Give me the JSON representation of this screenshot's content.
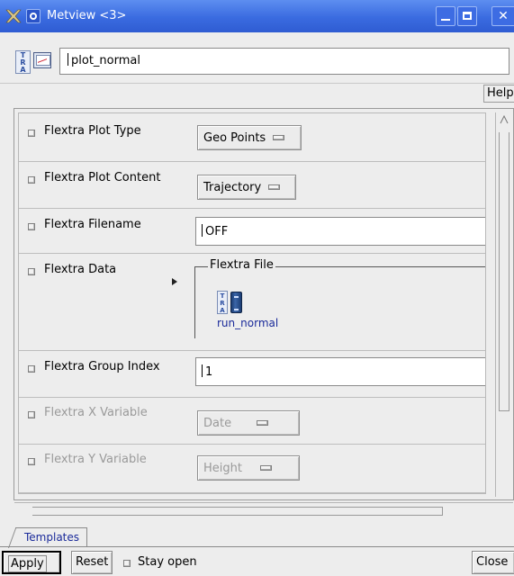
{
  "window": {
    "title": "Metview <3>"
  },
  "icon": {
    "name": "plot_normal"
  },
  "help_label": "Help",
  "params": [
    {
      "label": "Flextra Plot Type",
      "value": "Geo Points",
      "kind": "option",
      "enabled": true
    },
    {
      "label": "Flextra Plot Content",
      "value": "Trajectory",
      "kind": "option",
      "enabled": true
    },
    {
      "label": "Flextra Filename",
      "value": "OFF",
      "kind": "text",
      "enabled": true
    },
    {
      "label": "Flextra Data",
      "group_title": "Flextra File",
      "file_name": "run_normal",
      "file_icon_text": "TRA",
      "kind": "icon",
      "enabled": true
    },
    {
      "label": "Flextra Group Index",
      "value": "1",
      "kind": "text",
      "enabled": true
    },
    {
      "label": "Flextra X Variable",
      "value": "Date",
      "kind": "option",
      "enabled": false
    },
    {
      "label": "Flextra Y Variable",
      "value": "Height",
      "kind": "option",
      "enabled": false
    }
  ],
  "tabs": [
    {
      "label": "Templates"
    }
  ],
  "buttons": {
    "apply": "Apply",
    "reset": "Reset",
    "close": "Close"
  },
  "stay_open": {
    "label": "Stay open",
    "checked": false
  },
  "icons": {
    "app": "metview-logo-icon",
    "window_menu": "window-menu-icon",
    "minimize": "minimize-icon",
    "maximize": "maximize-icon",
    "close": "close-icon",
    "tra": "tra-icon",
    "plot": "plot-icon"
  }
}
